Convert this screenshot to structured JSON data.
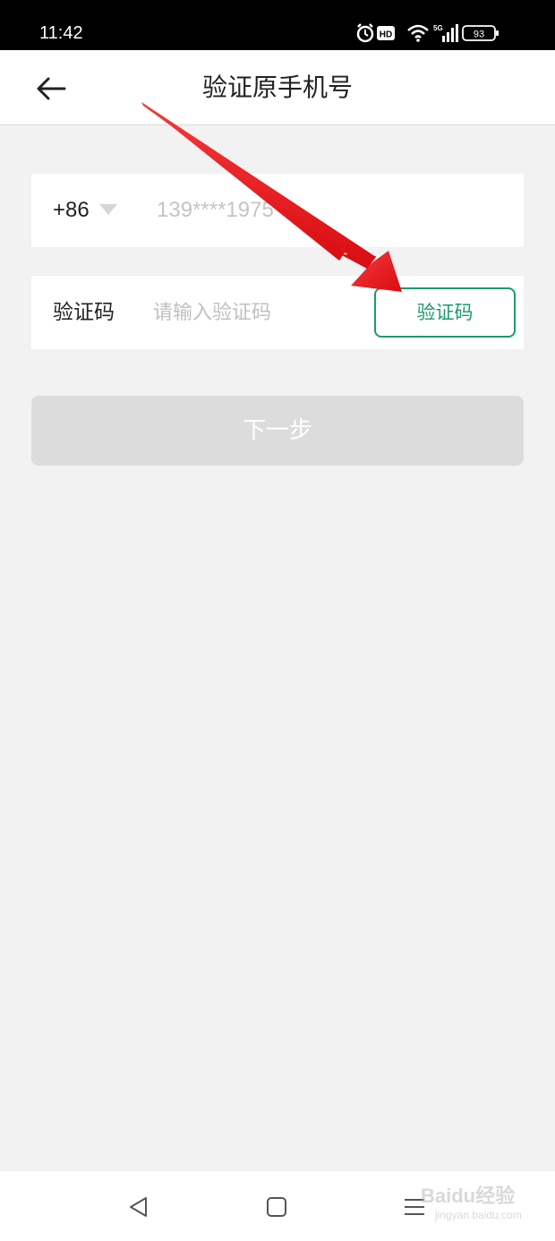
{
  "status_bar": {
    "time": "11:42",
    "network": "5G",
    "battery": "93",
    "icons": [
      "alarm-icon",
      "hd-icon",
      "wifi-icon",
      "signal-icon",
      "battery-icon"
    ]
  },
  "header": {
    "title": "验证原手机号",
    "back_icon": "back-arrow-icon"
  },
  "form": {
    "country_code": "+86",
    "phone_masked": "139****1975",
    "code_label": "验证码",
    "code_placeholder": "请输入验证码",
    "code_value": "",
    "get_code_label": "验证码",
    "next_label": "下一步"
  },
  "colors": {
    "accent_green": "#1a9b6c",
    "disabled_button": "#dcdcdc",
    "annotation_arrow": "#e8161a",
    "background": "#f2f2f2"
  },
  "annotation": {
    "type": "red-arrow",
    "points_to": "get-code-button"
  },
  "bottom_nav": {
    "icons": [
      "nav-back-icon",
      "nav-home-icon",
      "nav-menu-icon"
    ]
  },
  "watermark": {
    "text": "Baidu经验",
    "sub": "jingyan.baidu.com"
  }
}
